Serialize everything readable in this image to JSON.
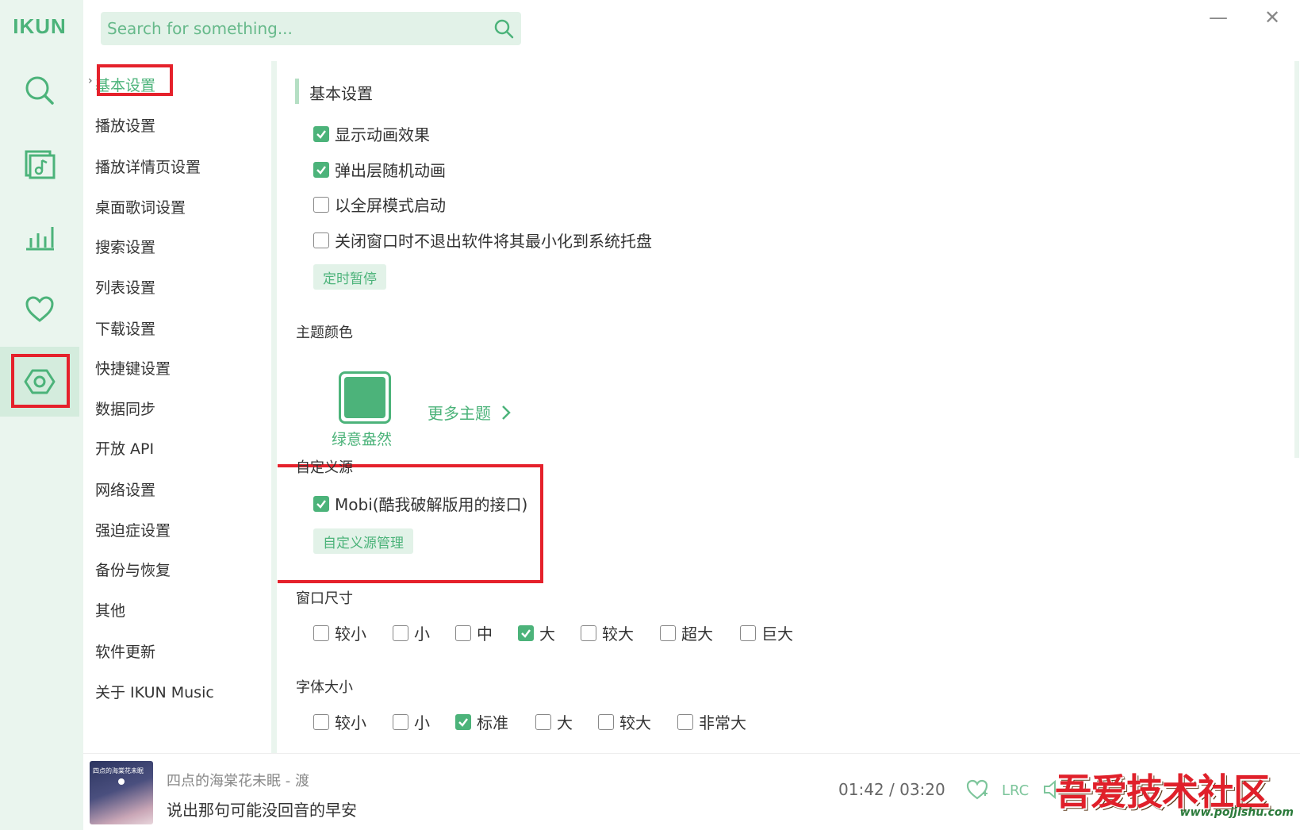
{
  "app": {
    "logo": "IKUN"
  },
  "search": {
    "placeholder": "Search for something..."
  },
  "window": {
    "minimize": "—",
    "close": "✕"
  },
  "rail": {
    "items": [
      {
        "icon": "search-icon"
      },
      {
        "icon": "music-list-icon"
      },
      {
        "icon": "chart-icon"
      },
      {
        "icon": "heart-icon"
      },
      {
        "icon": "settings-icon",
        "active": true
      }
    ]
  },
  "nav": {
    "items": [
      {
        "label": "基本设置",
        "active": true
      },
      {
        "label": "播放设置"
      },
      {
        "label": "播放详情页设置"
      },
      {
        "label": "桌面歌词设置"
      },
      {
        "label": "搜索设置"
      },
      {
        "label": "列表设置"
      },
      {
        "label": "下载设置"
      },
      {
        "label": "快捷键设置"
      },
      {
        "label": "数据同步"
      },
      {
        "label": "开放 API"
      },
      {
        "label": "网络设置"
      },
      {
        "label": "强迫症设置"
      },
      {
        "label": "备份与恢复"
      },
      {
        "label": "其他"
      },
      {
        "label": "软件更新"
      },
      {
        "label": "关于 IKUN Music"
      }
    ]
  },
  "basic": {
    "title": "基本设置",
    "options": [
      {
        "label": "显示动画效果",
        "checked": true
      },
      {
        "label": "弹出层随机动画",
        "checked": true
      },
      {
        "label": "以全屏模式启动",
        "checked": false
      },
      {
        "label": "关闭窗口时不退出软件将其最小化到系统托盘",
        "checked": false
      }
    ],
    "timer_button": "定时暂停"
  },
  "theme": {
    "title": "主题颜色",
    "current_name": "绿意盎然",
    "color": "#4cb37a",
    "more": "更多主题"
  },
  "custom_source": {
    "title": "自定义源",
    "option": {
      "label": "Mobi(酷我破解版用的接口)",
      "checked": true
    },
    "manage_button": "自定义源管理"
  },
  "window_size": {
    "title": "窗口尺寸",
    "options": [
      {
        "label": "较小",
        "checked": false
      },
      {
        "label": "小",
        "checked": false
      },
      {
        "label": "中",
        "checked": false
      },
      {
        "label": "大",
        "checked": true
      },
      {
        "label": "较大",
        "checked": false
      },
      {
        "label": "超大",
        "checked": false
      },
      {
        "label": "巨大",
        "checked": false
      }
    ]
  },
  "font_size": {
    "title": "字体大小",
    "options": [
      {
        "label": "较小",
        "checked": false
      },
      {
        "label": "小",
        "checked": false
      },
      {
        "label": "标准",
        "checked": true
      },
      {
        "label": "大",
        "checked": false
      },
      {
        "label": "较大",
        "checked": false
      },
      {
        "label": "非常大",
        "checked": false
      }
    ]
  },
  "player": {
    "cover_text": "四点的海棠花未眠",
    "title": "四点的海棠花未眠 - 渡",
    "lyric": "说出那句可能没回音的早安",
    "time_current": "01:42",
    "time_sep": "/",
    "time_total": "03:20",
    "lrc": "LRC"
  },
  "watermark": {
    "text": "吾爱技术社区",
    "url": "www.pojjishu.com"
  },
  "colors": {
    "accent": "#4cb37a",
    "highlight": "#e5212b",
    "rail_bg": "#eaf5ee"
  }
}
